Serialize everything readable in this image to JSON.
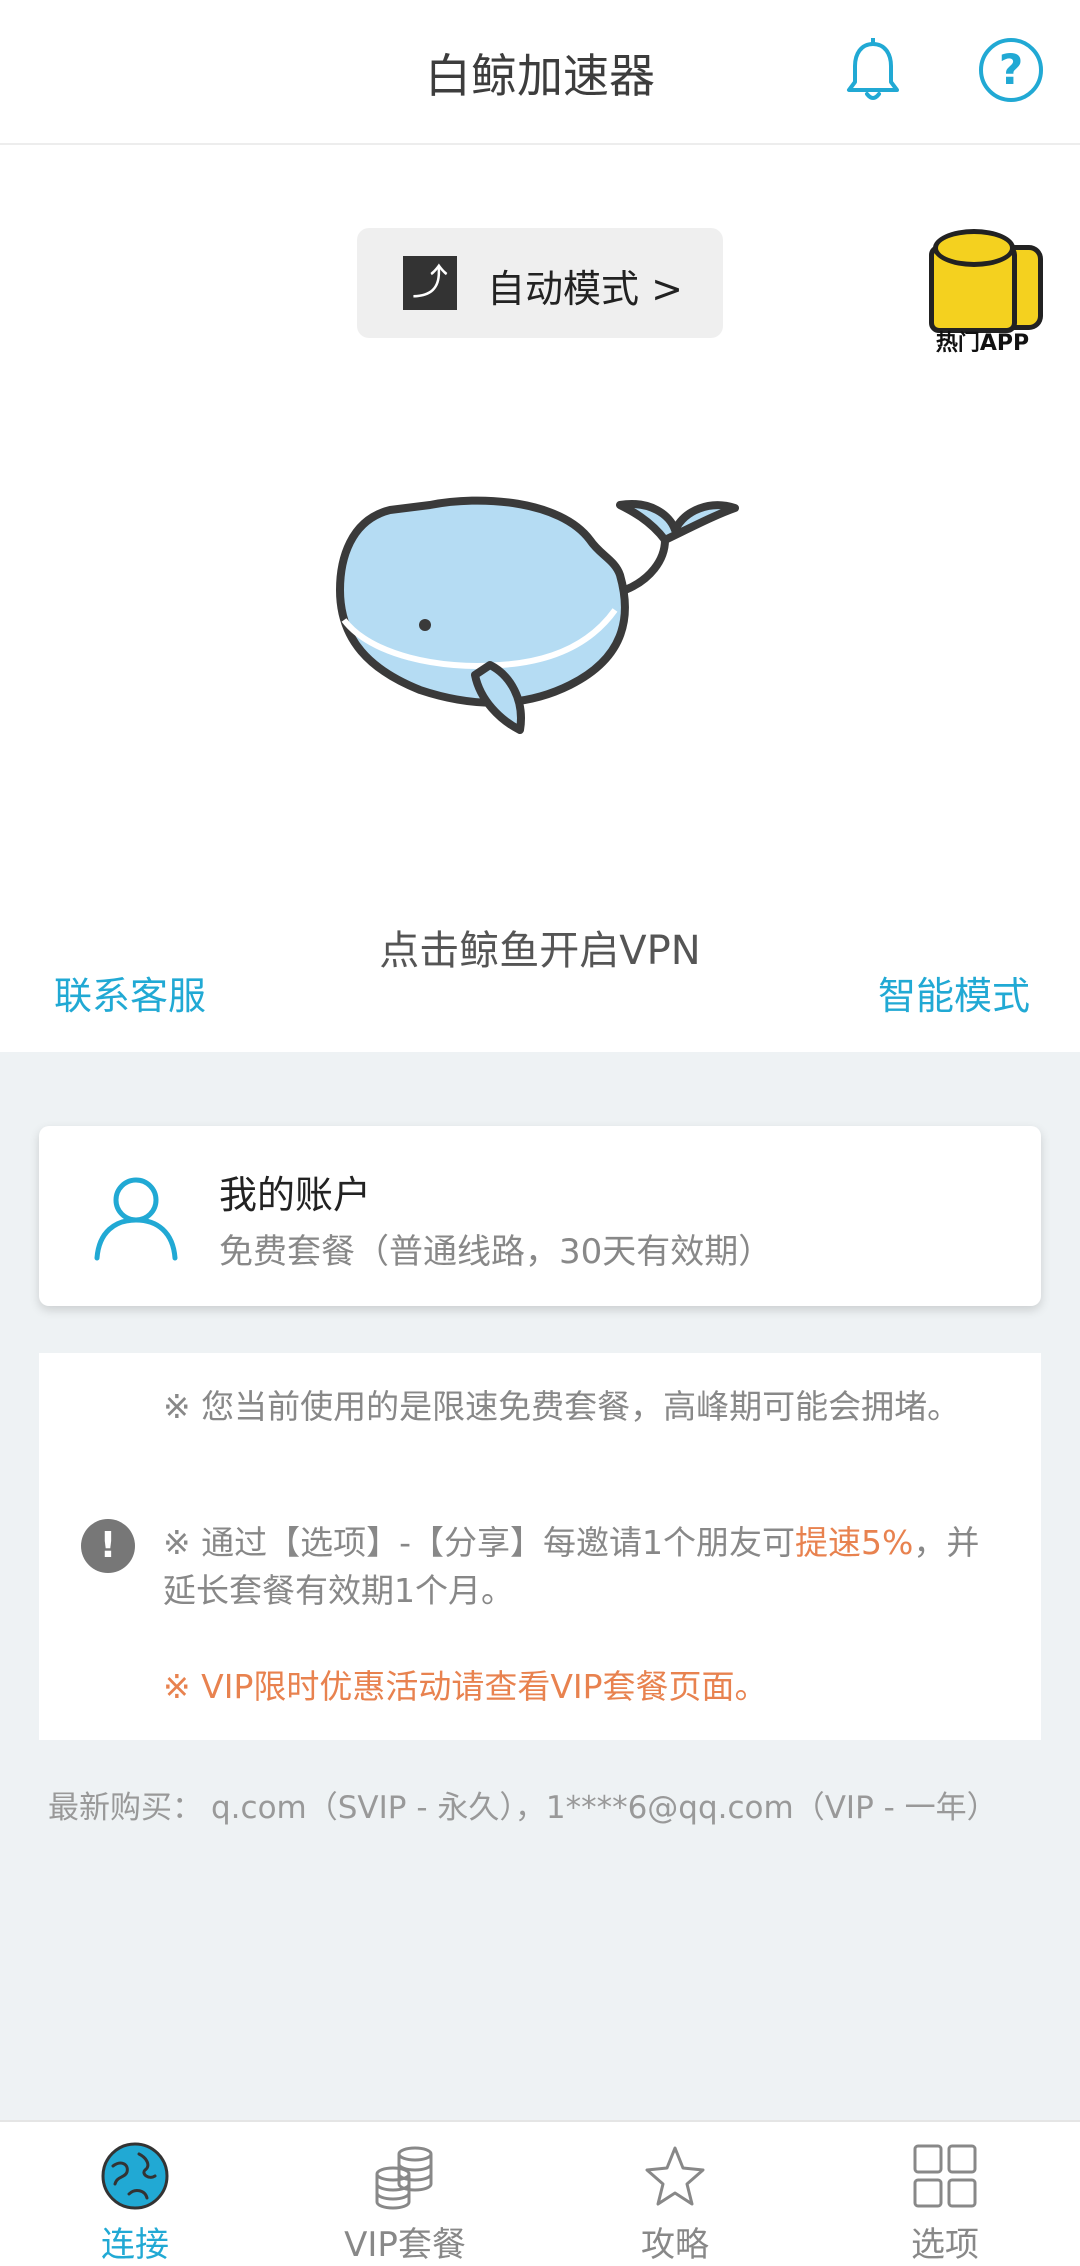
{
  "header": {
    "title": "白鲸加速器",
    "help_symbol": "?"
  },
  "mode_button": {
    "label": "自动模式 >"
  },
  "hot_app": {
    "label": "热门APP"
  },
  "main": {
    "tap_hint": "点击鲸鱼开启VPN",
    "contact_link": "联系客服",
    "smart_mode_link": "智能模式"
  },
  "account": {
    "title": "我的账户",
    "plan": "免费套餐（普通线路，30天有效期）"
  },
  "notices": {
    "line1": "※ 您当前使用的是限速免费套餐，高峰期可能会拥堵。",
    "line2_prefix": "※ 通过【选项】-【分享】每邀请1个朋友可",
    "line2_highlight": "提速5%",
    "line2_suffix": "，并延长套餐有效期1个月。",
    "line3": "※ VIP限时优惠活动请查看VIP套餐页面。",
    "alert_symbol": "!"
  },
  "recent_purchase": {
    "label": "最新购买：",
    "items": "q.com（SVIP - 永久），1****6@qq.com（VIP - 一年）"
  },
  "tabs": [
    {
      "label": "连接",
      "icon": "globe-icon",
      "active": true
    },
    {
      "label": "VIP套餐",
      "icon": "coins-icon",
      "active": false
    },
    {
      "label": "攻略",
      "icon": "star-icon",
      "active": false
    },
    {
      "label": "选项",
      "icon": "grid-icon",
      "active": false
    }
  ],
  "colors": {
    "accent": "#21a9d4",
    "highlight": "#e8824f",
    "whale_fill": "#b5dcf3",
    "outline": "#3a3a3a",
    "page_bg": "#eef2f4"
  }
}
